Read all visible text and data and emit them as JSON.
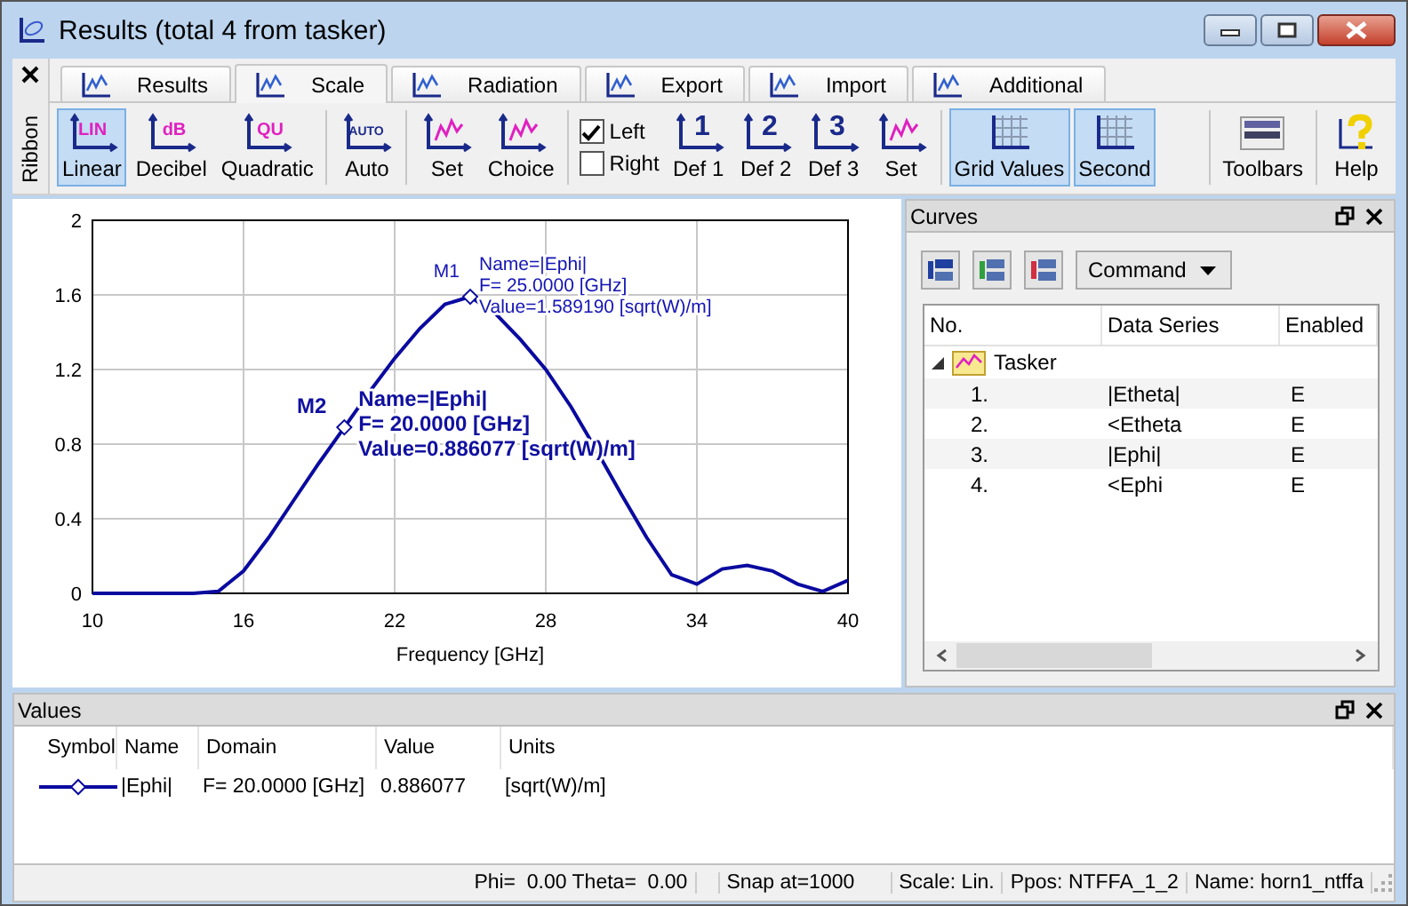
{
  "window": {
    "title": "Results (total 4 from tasker)"
  },
  "ribbon_strip": {
    "label": "Ribbon"
  },
  "tabs": [
    {
      "label": "Results",
      "selected": false
    },
    {
      "label": "Scale",
      "selected": true
    },
    {
      "label": "Radiation",
      "selected": false
    },
    {
      "label": "Export",
      "selected": false
    },
    {
      "label": "Import",
      "selected": false
    },
    {
      "label": "Additional",
      "selected": false
    }
  ],
  "ribbon_groups": [
    {
      "items": [
        {
          "kind": "tool",
          "label": "Linear",
          "icon_text": "LIN",
          "color": "#e020c0",
          "selected": true
        },
        {
          "kind": "tool",
          "label": "Decibel",
          "icon_text": "dB",
          "color": "#e020c0",
          "selected": false
        },
        {
          "kind": "tool",
          "label": "Quadratic",
          "icon_text": "QU",
          "color": "#e020c0",
          "selected": false
        }
      ]
    },
    {
      "items": [
        {
          "kind": "tool",
          "label": "Auto",
          "icon_text": "AUTO",
          "color": "#1a2a8a",
          "selected": false
        }
      ]
    },
    {
      "items": [
        {
          "kind": "tool",
          "label": "Set",
          "selected": false
        },
        {
          "kind": "tool",
          "label": "Choice",
          "selected": false
        }
      ]
    },
    {
      "items": [
        {
          "kind": "checks",
          "checks": [
            {
              "label": "Left",
              "checked": true
            },
            {
              "label": "Right",
              "checked": false
            }
          ]
        },
        {
          "kind": "tool",
          "label": "Def 1",
          "icon_text": "1",
          "color": "#1a2a8a",
          "selected": false
        },
        {
          "kind": "tool",
          "label": "Def 2",
          "icon_text": "2",
          "color": "#1a2a8a",
          "selected": false
        },
        {
          "kind": "tool",
          "label": "Def 3",
          "icon_text": "3",
          "color": "#1a2a8a",
          "selected": false
        },
        {
          "kind": "tool",
          "label": "Set",
          "selected": false
        }
      ]
    },
    {
      "items": [
        {
          "kind": "grid",
          "label": "Grid Values",
          "selected": true
        },
        {
          "kind": "grid",
          "label": "Second",
          "selected": true
        }
      ]
    }
  ],
  "ribbon_right": [
    {
      "kind": "toolbars",
      "label": "Toolbars",
      "selected": false
    },
    {
      "kind": "help",
      "label": "Help",
      "selected": false
    }
  ],
  "chart_data": {
    "type": "line",
    "xlabel": "Frequency [GHz]",
    "x": [
      10,
      11,
      12,
      13,
      14,
      15,
      16,
      17,
      18,
      19,
      20,
      21,
      22,
      23,
      24,
      25,
      26,
      27,
      28,
      29,
      30,
      31,
      32,
      33,
      34,
      35,
      36,
      37,
      38,
      39,
      40
    ],
    "series": [
      {
        "color": "#0a0aa0",
        "values": [
          0,
          0,
          0,
          0,
          0,
          0.01,
          0.12,
          0.3,
          0.5,
          0.7,
          0.89,
          1.08,
          1.26,
          1.42,
          1.55,
          1.59,
          1.5,
          1.36,
          1.2,
          1.0,
          0.77,
          0.53,
          0.3,
          0.1,
          0.05,
          0.13,
          0.15,
          0.12,
          0.05,
          0.01,
          0.07
        ]
      }
    ],
    "xlim": [
      10,
      40
    ],
    "ylim": [
      0,
      2
    ],
    "xticks": [
      10,
      16,
      22,
      28,
      34,
      40
    ],
    "yticks": [
      0,
      0.4,
      0.8,
      1.2,
      1.6,
      2
    ],
    "grid": true,
    "annotations": [
      {
        "text": "M1",
        "x": 25,
        "y": 1.59
      },
      {
        "text": "M2",
        "x": 20,
        "y": 0.89
      }
    ]
  },
  "chart_markers": [
    {
      "lines": [
        "Name=|Ephi|",
        "F= 25.0000 [GHz]",
        "Value=1.589190 [sqrt(W)/m]"
      ],
      "emphasis": false
    },
    {
      "lines": [
        "Name=|Ephi|",
        "F= 20.0000 [GHz]",
        "Value=0.886077 [sqrt(W)/m]"
      ],
      "emphasis": true
    }
  ],
  "curves": {
    "title": "Curves",
    "command": "Command",
    "columns": [
      "No.",
      "Data Series",
      "Enabled"
    ],
    "tree": [
      {
        "label": "Tasker",
        "expanded": true,
        "children": [
          {
            "no": "1.",
            "series": "|Etheta|",
            "enabled": "E"
          },
          {
            "no": "2.",
            "series": "<Etheta",
            "enabled": "E"
          },
          {
            "no": "3.",
            "series": "|Ephi|",
            "enabled": "E"
          },
          {
            "no": "4.",
            "series": "<Ephi",
            "enabled": "E"
          }
        ]
      }
    ]
  },
  "values": {
    "title": "Values",
    "columns": [
      "Symbol",
      "Name",
      "Domain",
      "Value",
      "Units"
    ],
    "rows": [
      {
        "name": "|Ephi|",
        "domain": "F= 20.0000 [GHz]",
        "value": "0.886077",
        "units": "[sqrt(W)/m]"
      }
    ]
  },
  "status_bar": [
    "Phi=  0.00 Theta=  0.00",
    "Snap at=1000",
    "Scale: Lin.",
    "Ppos: NTFFA_1_2",
    "Name: horn1_ntffa"
  ]
}
